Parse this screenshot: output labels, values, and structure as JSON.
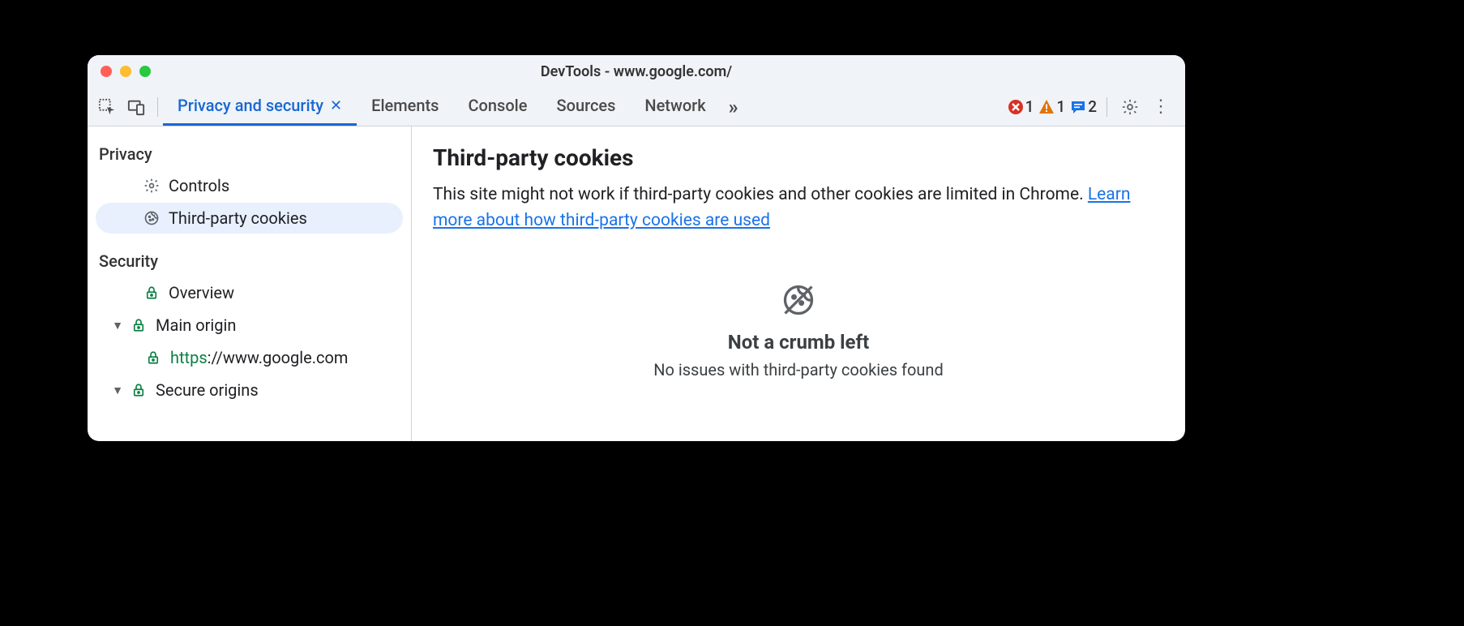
{
  "window": {
    "title": "DevTools - www.google.com/"
  },
  "toolbar": {
    "tabs": {
      "active": "Privacy and security",
      "items": [
        "Elements",
        "Console",
        "Sources",
        "Network"
      ]
    },
    "badges": {
      "errors": "1",
      "warnings": "1",
      "messages": "2"
    }
  },
  "sidebar": {
    "privacy": {
      "title": "Privacy",
      "controls": "Controls",
      "third_party": "Third-party cookies"
    },
    "security": {
      "title": "Security",
      "overview": "Overview",
      "main_origin": "Main origin",
      "origin_url_scheme": "https",
      "origin_url_rest": "://www.google.com",
      "secure_origins": "Secure origins"
    }
  },
  "main": {
    "heading": "Third-party cookies",
    "description_before": "This site might not work if third-party cookies and other cookies are limited in Chrome. ",
    "learn_more": "Learn more about how third-party cookies are used",
    "empty_title": "Not a crumb left",
    "empty_sub": "No issues with third-party cookies found"
  }
}
